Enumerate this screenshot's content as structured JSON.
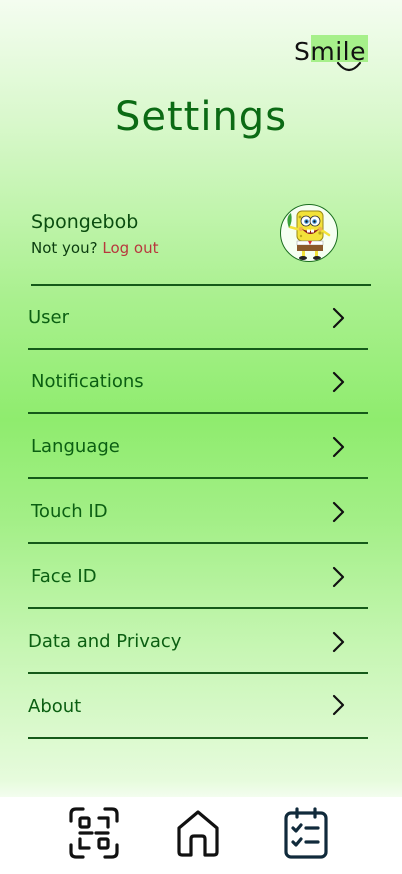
{
  "app": {
    "logo_text": "Smile"
  },
  "header": {
    "title": "Settings"
  },
  "profile": {
    "name": "Spongebob",
    "prompt": "Not you?",
    "logout_label": "Log out",
    "avatar": "spongebob-avatar"
  },
  "menu": {
    "items": [
      {
        "label": "User",
        "icon": "chevron-right-icon"
      },
      {
        "label": "Notifications",
        "icon": "chevron-right-icon"
      },
      {
        "label": "Language",
        "icon": "chevron-right-icon"
      },
      {
        "label": "Touch ID",
        "icon": "chevron-right-icon"
      },
      {
        "label": "Face ID",
        "icon": "chevron-right-icon"
      },
      {
        "label": "Data and Privacy",
        "icon": "chevron-right-icon"
      },
      {
        "label": "About",
        "icon": "chevron-right-icon"
      }
    ]
  },
  "tabbar": {
    "items": [
      {
        "icon": "qr-scan-icon",
        "active": false
      },
      {
        "icon": "home-icon",
        "active": false
      },
      {
        "icon": "checklist-icon",
        "active": true
      }
    ]
  },
  "colors": {
    "title_green": "#0b6a14",
    "logout_red": "#b8383d",
    "divider": "#155a19",
    "active_tab": "#102a3b"
  }
}
